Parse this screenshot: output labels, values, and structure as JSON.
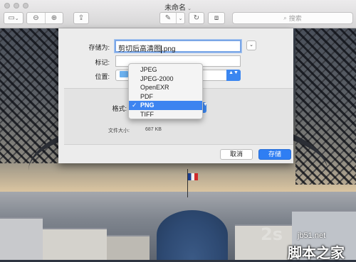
{
  "window": {
    "title": "未命名",
    "title_chevron": "⌄"
  },
  "toolbar": {
    "sidebar_icon": "▭",
    "sidebar_chevron": "⌄",
    "zoom_out_icon": "⊖",
    "zoom_in_icon": "⊕",
    "share_icon": "⇪",
    "markup_icon": "✎",
    "markup_chevron": "⌄",
    "rotate_icon": "↻",
    "toolbox_icon": "⧈",
    "search_placeholder": "搜索"
  },
  "save_sheet": {
    "save_as_label": "存储为:",
    "filename_before_caret": "剪切后高清图",
    "filename_after_caret": ".png",
    "expand_icon": "⌄",
    "tags_label": "标记:",
    "tags_value": "",
    "location_label": "位置:",
    "location_stepper": "▲▼",
    "format_label": "格式:",
    "format_stepper": "▲▼",
    "file_size_label": "文件大小:",
    "file_size_value": "687 KB",
    "cancel_button": "取消",
    "save_button": "存储"
  },
  "format_menu": {
    "items": [
      "JPEG",
      "JPEG-2000",
      "OpenEXR",
      "PDF",
      "PNG",
      "TIFF"
    ],
    "selected": "PNG",
    "check_mark": "✓"
  },
  "watermark": {
    "line1": "2s",
    "line2": "jb51.net",
    "line3": "脚本之家"
  },
  "colors": {
    "accent": "#3b86f0",
    "save_button": "#2f7ef3",
    "sheet_background": "#ececec"
  }
}
